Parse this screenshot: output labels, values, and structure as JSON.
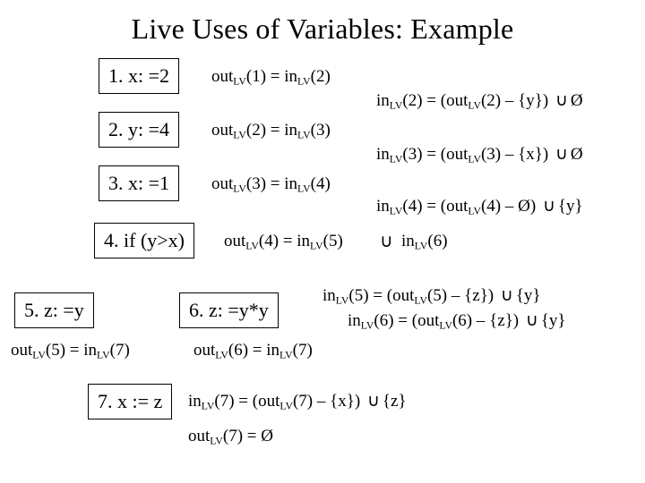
{
  "title": "Live Uses of Variables: Example",
  "nodes": {
    "n1": "1. x: =2",
    "n2": "2. y: =4",
    "n3": "3. x: =1",
    "n4": "4. if (y>x)",
    "n5": "5. z: =y",
    "n6": "6. z: =y*y",
    "n7": "7. x := z"
  },
  "eqs": {
    "out1": {
      "pre": "out",
      "sub": "LV",
      "after": "(1) = in",
      "sub2": "LV",
      "tail": "(2)"
    },
    "out2": {
      "pre": "out",
      "sub": "LV",
      "after": "(2) = in",
      "sub2": "LV",
      "tail": "(3)"
    },
    "out3": {
      "pre": "out",
      "sub": "LV",
      "after": "(3) = in",
      "sub2": "LV",
      "tail": "(4)"
    },
    "out4a": {
      "pre": "out",
      "sub": "LV",
      "after": "(4) = in",
      "sub2": "LV",
      "tail": "(5)"
    },
    "out4b": {
      "pre": "in",
      "sub": "LV",
      "after": "(6)",
      "sub2": "",
      "tail": ""
    },
    "out5": {
      "pre": "out",
      "sub": "LV",
      "after": "(5) = in",
      "sub2": "LV",
      "tail": "(7)"
    },
    "out6": {
      "pre": "out",
      "sub": "LV",
      "after": "(6) = in",
      "sub2": "LV",
      "tail": "(7)"
    },
    "out7": {
      "pre": "out",
      "sub": "LV",
      "after": "(7) = Ø",
      "sub2": "",
      "tail": ""
    },
    "in2": {
      "pre": "in",
      "sub": "LV",
      "after": "(2) = (out",
      "sub2": "LV",
      "tail": "(2) – {y})"
    },
    "in2r": "Ø",
    "in3": {
      "pre": "in",
      "sub": "LV",
      "after": "(3) = (out",
      "sub2": "LV",
      "tail": "(3) – {x})"
    },
    "in3r": "Ø",
    "in4": {
      "pre": "in",
      "sub": "LV",
      "after": "(4) = (out",
      "sub2": "LV",
      "tail": "(4) – Ø)"
    },
    "in4r": "{y}",
    "in5": {
      "pre": "in",
      "sub": "LV",
      "after": "(5) = (out",
      "sub2": "LV",
      "tail": "(5) – {z})"
    },
    "in5r": "{y}",
    "in6": {
      "pre": "in",
      "sub": "LV",
      "after": "(6) = (out",
      "sub2": "LV",
      "tail": "(6) – {z})"
    },
    "in6r": "{y}",
    "in7": {
      "pre": "in",
      "sub": "LV",
      "after": "(7) = (out",
      "sub2": "LV",
      "tail": "(7) – {x})"
    },
    "in7r": "{z}",
    "cup": "∪",
    "cup2": "∪"
  }
}
